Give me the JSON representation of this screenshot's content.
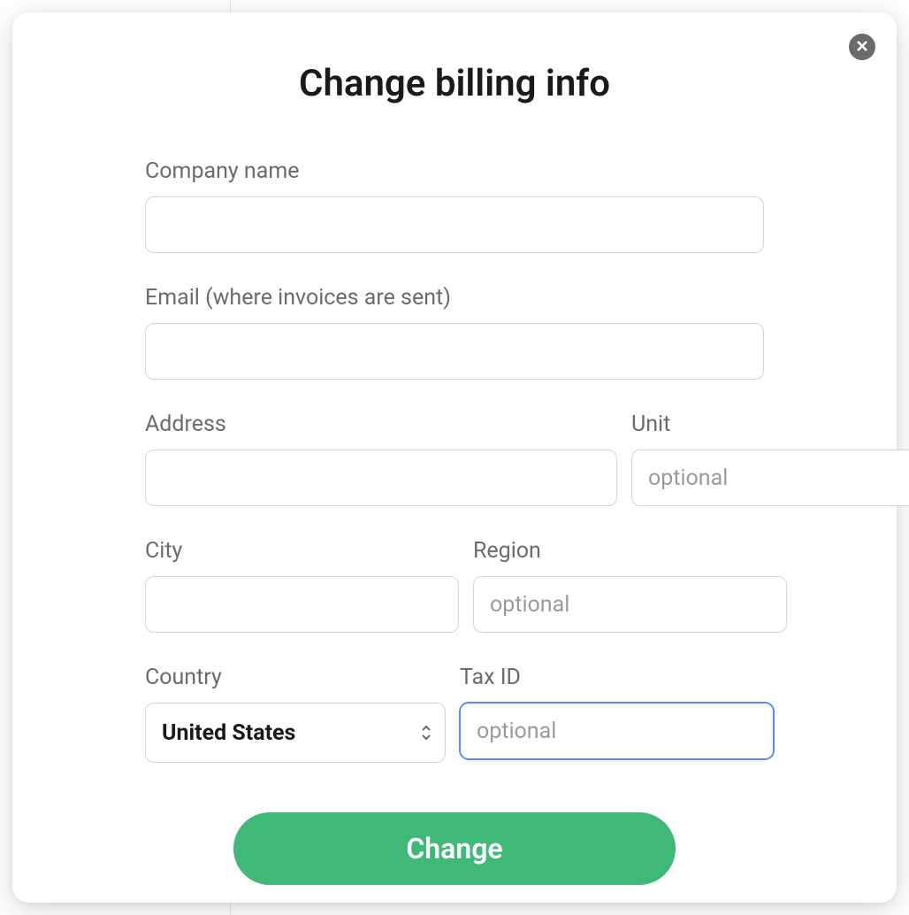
{
  "modal": {
    "title": "Change billing info",
    "fields": {
      "company_name": {
        "label": "Company name",
        "value": ""
      },
      "email": {
        "label": "Email (where invoices are sent)",
        "value": ""
      },
      "address": {
        "label": "Address",
        "value": ""
      },
      "unit": {
        "label": "Unit",
        "value": "",
        "placeholder": "optional"
      },
      "city": {
        "label": "City",
        "value": ""
      },
      "region": {
        "label": "Region",
        "value": "",
        "placeholder": "optional"
      },
      "country": {
        "label": "Country",
        "selected": "United States"
      },
      "tax_id": {
        "label": "Tax ID",
        "value": "",
        "placeholder": "optional"
      }
    },
    "submit_label": "Change"
  }
}
